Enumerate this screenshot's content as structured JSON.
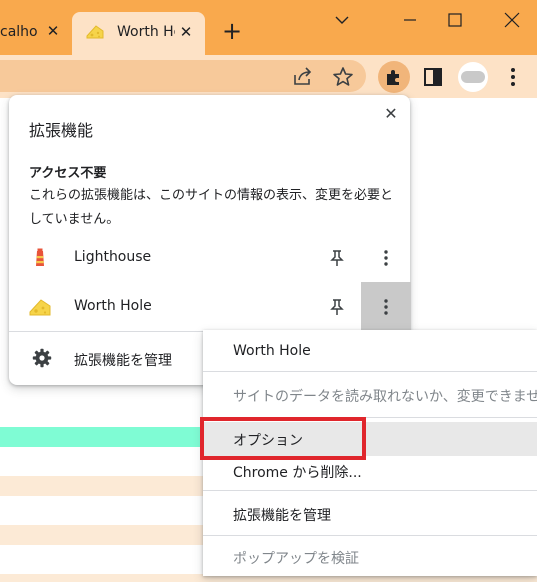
{
  "colors": {
    "frame": "#f9a94d",
    "toolbar": "#fde2c6",
    "omnibox": "#f7c99a",
    "page_stripe_accent": "#7ffcd4",
    "page_stripe_light": "#fcead6",
    "highlight": "#e0262c"
  },
  "tabs": [
    {
      "title": "calhost",
      "icon": "none",
      "close_icon": "close-icon"
    },
    {
      "title": "Worth Hole",
      "icon": "cheese-icon",
      "close_icon": "close-icon"
    }
  ],
  "new_tab_label": "+",
  "toolbar_icons": [
    "share-icon",
    "star-icon",
    "puzzle-icon",
    "sidepanel-icon",
    "profile-avatar",
    "kebab-icon"
  ],
  "extensions_popup": {
    "title": "拡張機能",
    "section_title": "アクセス不要",
    "description": "これらの拡張機能は、このサイトの情報の表示、変更を必要としていません。",
    "items": [
      {
        "name": "Lighthouse",
        "icon": "lighthouse-icon"
      },
      {
        "name": "Worth Hole",
        "icon": "cheese-icon"
      }
    ],
    "manage_label": "拡張機能を管理"
  },
  "context_menu": {
    "header": "Worth Hole",
    "site_access": "サイトのデータを読み取れないか、変更できません",
    "options": "オプション",
    "remove": "Chrome から削除...",
    "manage": "拡張機能を管理",
    "inspect_popup": "ポップアップを検証"
  }
}
